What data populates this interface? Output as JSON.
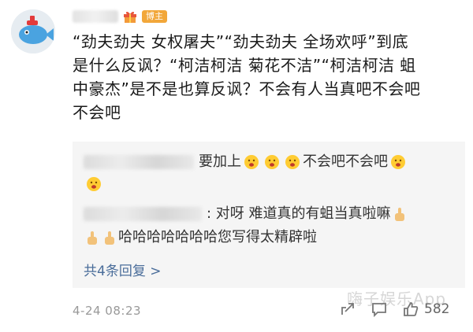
{
  "post": {
    "badge_label": "博主",
    "lines": [
      "“劲夫劲夫 女权屠夫”“劲夫劲夫 全场欢呼”到底",
      "是什么反讽？“柯洁柯洁 菊花不洁”“柯洁柯洁 蛆",
      "中豪杰”是不是也算反讽？不会有人当真吧不会吧",
      "不会吧"
    ]
  },
  "comments": {
    "first": {
      "text": "要加上",
      "text2": "不会吧不会吧"
    },
    "second": {
      "text": ": 对呀  难道真的有蛆当真啦嘛",
      "text2": "哈哈哈哈哈哈哈您写得太精辟啦"
    },
    "reply_link": "共4条回复 >"
  },
  "footer": {
    "timestamp": "4-24 08:23",
    "like_count": "582"
  },
  "watermark": "嗨子娱乐App",
  "icons": [
    "avatar-fish-icon",
    "gift-icon",
    "emoji-face-icon",
    "thumbs-up-icon",
    "share-icon",
    "comment-icon",
    "like-icon"
  ],
  "colors": {
    "badge": "#f2a73a",
    "link": "#4a6d9a",
    "comment_bg": "#f5f5f5"
  }
}
